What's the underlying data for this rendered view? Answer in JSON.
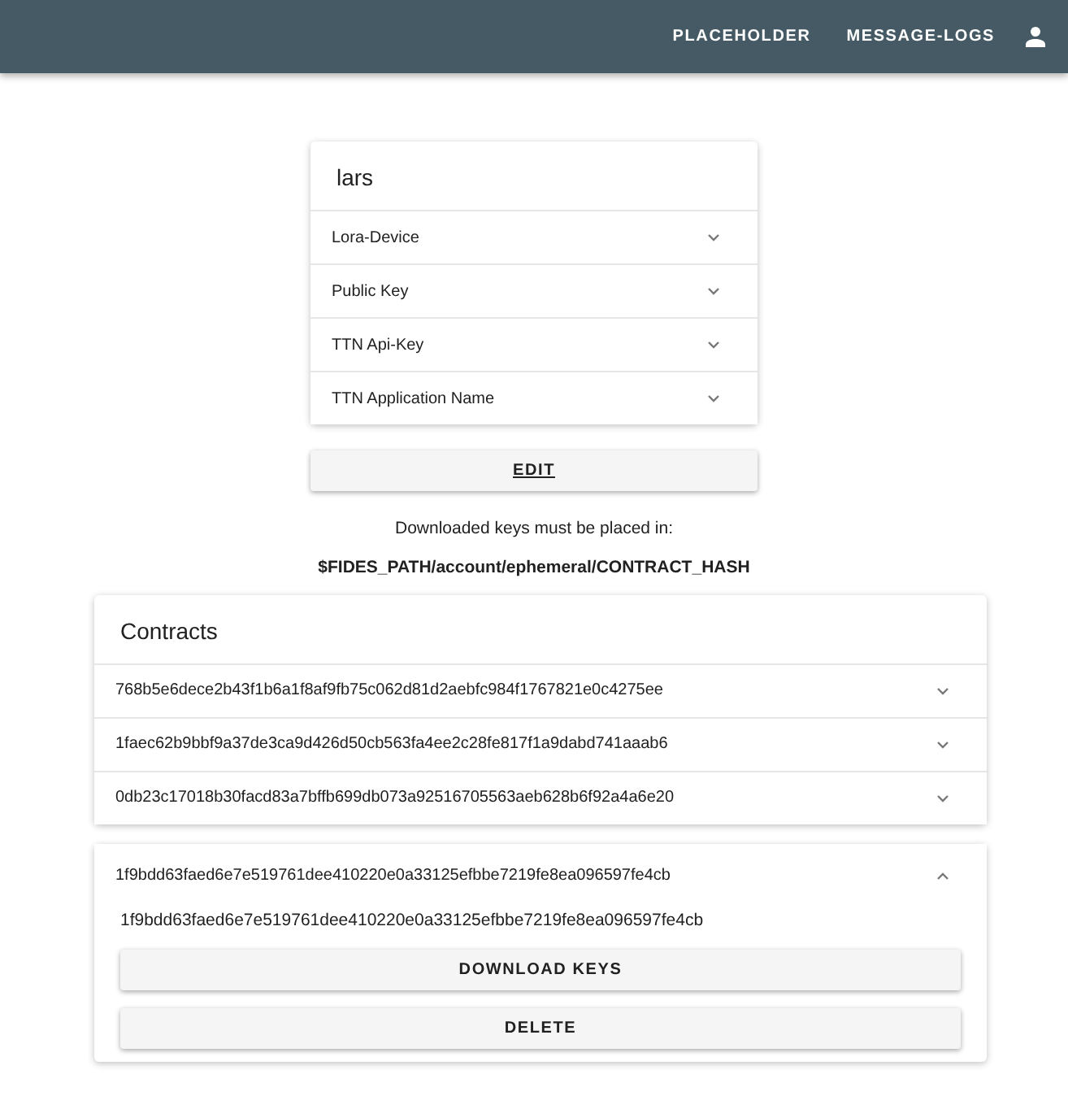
{
  "navbar": {
    "links": [
      "PLACEHOLDER",
      "MESSAGE-LOGS"
    ]
  },
  "user_card": {
    "title": "lars",
    "panels": [
      {
        "label": "Lora-Device",
        "expanded": false
      },
      {
        "label": "Public Key",
        "expanded": false
      },
      {
        "label": "TTN Api-Key",
        "expanded": false
      },
      {
        "label": "TTN Application Name",
        "expanded": false
      }
    ],
    "button": "EDIT"
  },
  "info": {
    "line": "Downloaded keys must be placed in:",
    "path": "$FIDES_PATH/account/ephemeral/CONTRACT_HASH"
  },
  "contracts": {
    "title": "Contracts",
    "panels": [
      {
        "label": "768b5e6dece2b43f1b6a1f8af9fb75c062d81d2aebfc984f1767821e0c4275ee",
        "expanded": false
      },
      {
        "label": "1faec62b9bbf9a37de3ca9d426d50cb563fa4ee2c28fe817f1a9dabd741aaab6",
        "expanded": false
      },
      {
        "label": "0db23c17018b30facd83a7bffb699db073a92516705563aeb628b6f92a4a6e20",
        "expanded": false
      },
      {
        "label": "1f9bdd63faed6e7e519761dee410220e0a33125efbbe7219fe8ea096597fe4cb",
        "expanded": true,
        "content": "1f9bdd63faed6e7e519761dee410220e0a33125efbbe7219fe8ea096597fe4cb",
        "buttons": [
          "DOWNLOAD KEYS",
          "DELETE"
        ]
      }
    ]
  }
}
